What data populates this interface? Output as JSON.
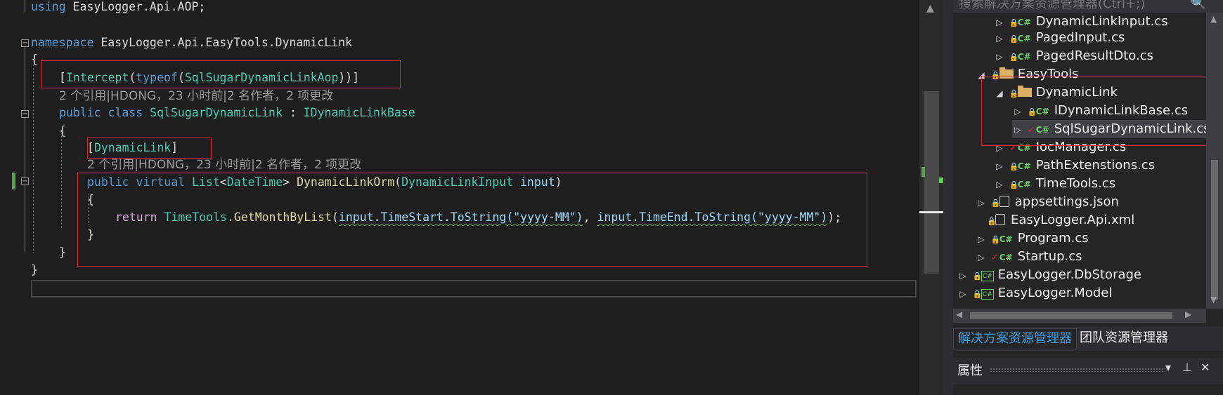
{
  "editor": {
    "lines": {
      "using": {
        "kw": "using",
        "rest": " EasyLogger.Api.AOP;"
      },
      "namespace": {
        "kw": "namespace",
        "rest": " EasyLogger.Api.EasyTools.DynamicLink"
      },
      "brace_open": "{",
      "attr_intercept": {
        "open": "[",
        "type": "Intercept",
        "p1": "(",
        "kw": "typeof",
        "p2": "(",
        "arg": "SqlSugarDynamicLinkAop",
        "close": "))]"
      },
      "codelens_class": "2 个引用|HDONG，23 小时前|2 名作者，2 项更改",
      "class_decl": {
        "kw": "public class",
        "name": "SqlSugarDynamicLink",
        "sep": " : ",
        "base": "IDynamicLinkBase"
      },
      "class_brace_open": "{",
      "attr_dynamic": {
        "open": "[",
        "type": "DynamicLink",
        "close": "]"
      },
      "codelens_method": "2 个引用|HDONG，23 小时前|2 名作者，2 项更改",
      "method_decl": {
        "kw": "public virtual",
        "type": "List",
        "lt": "<",
        "targ": "DateTime",
        "gt": ">",
        "name": "DynamicLinkOrm",
        "p_open": "(",
        "ptype": "DynamicLinkInput",
        "pname": "input",
        "p_close": ")"
      },
      "method_brace_open": "{",
      "return_stmt": {
        "kw": "return",
        "cls": "TimeTools",
        "dot": ".",
        "fn": "GetMonthByList",
        "a1": "(",
        "arg1": "input.TimeStart.ToString(\"yyyy-MM\")",
        "comma": ", ",
        "arg2": "input.TimeEnd.ToString(\"yyyy-MM\")",
        "end": ");"
      },
      "method_brace_close": "}",
      "class_brace_close": "}",
      "brace_close": "}"
    },
    "fold_glyph": "−"
  },
  "scrollbar": {
    "up_arrow": "▲"
  },
  "solution_explorer": {
    "search_placeholder": "搜索解决方案资源管理器(Ctrl+;)",
    "search_icon": "🔍",
    "items": [
      {
        "label": "DynamicLinkInput.cs",
        "icon": "csharp-file-icon"
      },
      {
        "label": "PagedInput.cs",
        "icon": "csharp-file-icon"
      },
      {
        "label": "PagedResultDto.cs",
        "icon": "csharp-file-icon"
      },
      {
        "label": "EasyTools",
        "icon": "folder-icon"
      },
      {
        "label": "DynamicLink",
        "icon": "folder-icon"
      },
      {
        "label": "IDynamicLinkBase.cs",
        "icon": "csharp-file-icon"
      },
      {
        "label": "SqlSugarDynamicLink.cs",
        "icon": "csharp-file-icon"
      },
      {
        "label": "IocManager.cs",
        "icon": "csharp-file-icon"
      },
      {
        "label": "PathExtenstions.cs",
        "icon": "csharp-file-icon"
      },
      {
        "label": "TimeTools.cs",
        "icon": "csharp-file-icon"
      },
      {
        "label": "appsettings.json",
        "icon": "json-file-icon"
      },
      {
        "label": "EasyLogger.Api.xml",
        "icon": "xml-file-icon"
      },
      {
        "label": "Program.cs",
        "icon": "csharp-file-icon"
      },
      {
        "label": "Startup.cs",
        "icon": "csharp-file-icon"
      },
      {
        "label": "EasyLogger.DbStorage",
        "icon": "csharp-project-icon"
      },
      {
        "label": "EasyLogger.Model",
        "icon": "csharp-project-icon"
      }
    ],
    "glyphs": {
      "collapsed": "▷",
      "expanded": "◢",
      "lock": "🔒",
      "check": "✓",
      "cs": "C#"
    }
  },
  "tabs": {
    "solution": "解决方案资源管理器",
    "team": "团队资源管理器"
  },
  "properties": {
    "title": "属性",
    "dropdown": "▾",
    "pin": "⊥",
    "close": "✕"
  },
  "colors": {
    "keyword": "#569cd6",
    "type": "#4ec9b0",
    "string": "#d69d85",
    "highlight_box": "#e0282d",
    "tab_active": "#3e9ee8"
  }
}
